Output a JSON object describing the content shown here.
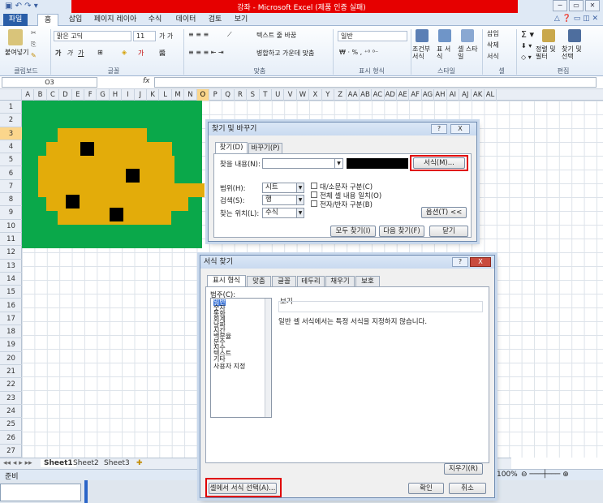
{
  "window": {
    "title": "강좌 - Microsoft Excel (제품 인증 실패)"
  },
  "tabs": [
    "파일",
    "홈",
    "삽입",
    "페이지 레이아웃",
    "수식",
    "데이터",
    "검토",
    "보기"
  ],
  "ribbon": {
    "paste": "붙여넣기",
    "font_name": "맑은 고딕",
    "font_size": "11",
    "wrap_text": "텍스트 줄 바꿈",
    "merge_center": "병합하고 가운데 맞춤",
    "number_format": "일반",
    "cond_format": "조건부 서식",
    "table_format": "표 서식",
    "cell_style": "셀 스타일",
    "insert": "삽입",
    "delete": "삭제",
    "format": "서식",
    "sort_filter": "정렬 및 필터",
    "find_select": "찾기 및 선택",
    "groups": [
      "클립보드",
      "글꼴",
      "맞춤",
      "표시 형식",
      "스타일",
      "셀",
      "편집"
    ]
  },
  "formula_bar": {
    "name_box": "O3",
    "fx": "fx",
    "value": ""
  },
  "columns": [
    "A",
    "B",
    "C",
    "D",
    "E",
    "F",
    "G",
    "H",
    "I",
    "J",
    "K",
    "L",
    "M",
    "N",
    "O",
    "P",
    "Q",
    "R",
    "S",
    "T",
    "U",
    "V",
    "W",
    "X",
    "Y",
    "Z",
    "AA",
    "AB",
    "AC",
    "AD",
    "AE",
    "AF",
    "AG",
    "AH",
    "AI",
    "AJ",
    "AK",
    "AL"
  ],
  "rows": [
    "1",
    "2",
    "3",
    "4",
    "5",
    "6",
    "7",
    "8",
    "9",
    "10",
    "11",
    "12",
    "13",
    "14",
    "15",
    "16",
    "17",
    "18",
    "19",
    "20",
    "21",
    "22",
    "23",
    "24",
    "25",
    "26",
    "27"
  ],
  "sheets": [
    "Sheet1",
    "Sheet2",
    "Sheet3"
  ],
  "status": {
    "ready": "준비",
    "zoom": "100%"
  },
  "find_dialog": {
    "title": "찾기 및 바꾸기",
    "help": "?",
    "close": "X",
    "tab_find": "찾기(D)",
    "tab_replace": "바꾸기(P)",
    "find_label": "찾을 내용(N):",
    "find_value": "",
    "format_button": "서식(M)...",
    "within_label": "범위(H):",
    "within_value": "시트",
    "search_label": "검색(S):",
    "search_value": "행",
    "lookin_label": "찾는 위치(L):",
    "lookin_value": "수식",
    "match_case": "대/소문자 구분(C)",
    "match_entire": "전체 셀 내용 일치(O)",
    "match_byte": "전자/반자 구분(B)",
    "options_button": "옵션(T) <<",
    "find_all": "모두 찾기(I)",
    "find_next": "다음 찾기(F)",
    "close_button": "닫기"
  },
  "format_dialog": {
    "title": "서식 찾기",
    "help": "?",
    "close": "X",
    "tabs": [
      "표시 형식",
      "맞춤",
      "글꼴",
      "테두리",
      "채우기",
      "보호"
    ],
    "category_label": "범주(C):",
    "categories": [
      "일반",
      "숫자",
      "통화",
      "회계",
      "날짜",
      "시간",
      "백분율",
      "분수",
      "지수",
      "텍스트",
      "기타",
      "사용자 지정"
    ],
    "sample_label": "보기",
    "description": "일반 셀 서식에서는 특정 서식을 지정하지 않습니다.",
    "clear_button": "지우기(R)",
    "choose_from_cell": "셀에서 서식 선택(A)...",
    "ok": "확인",
    "cancel": "취소"
  },
  "colors": {
    "art_green": "#0aa84a",
    "art_yellow": "#e3ac0a",
    "highlight_red": "#e00000",
    "title_red": "#e60000"
  }
}
